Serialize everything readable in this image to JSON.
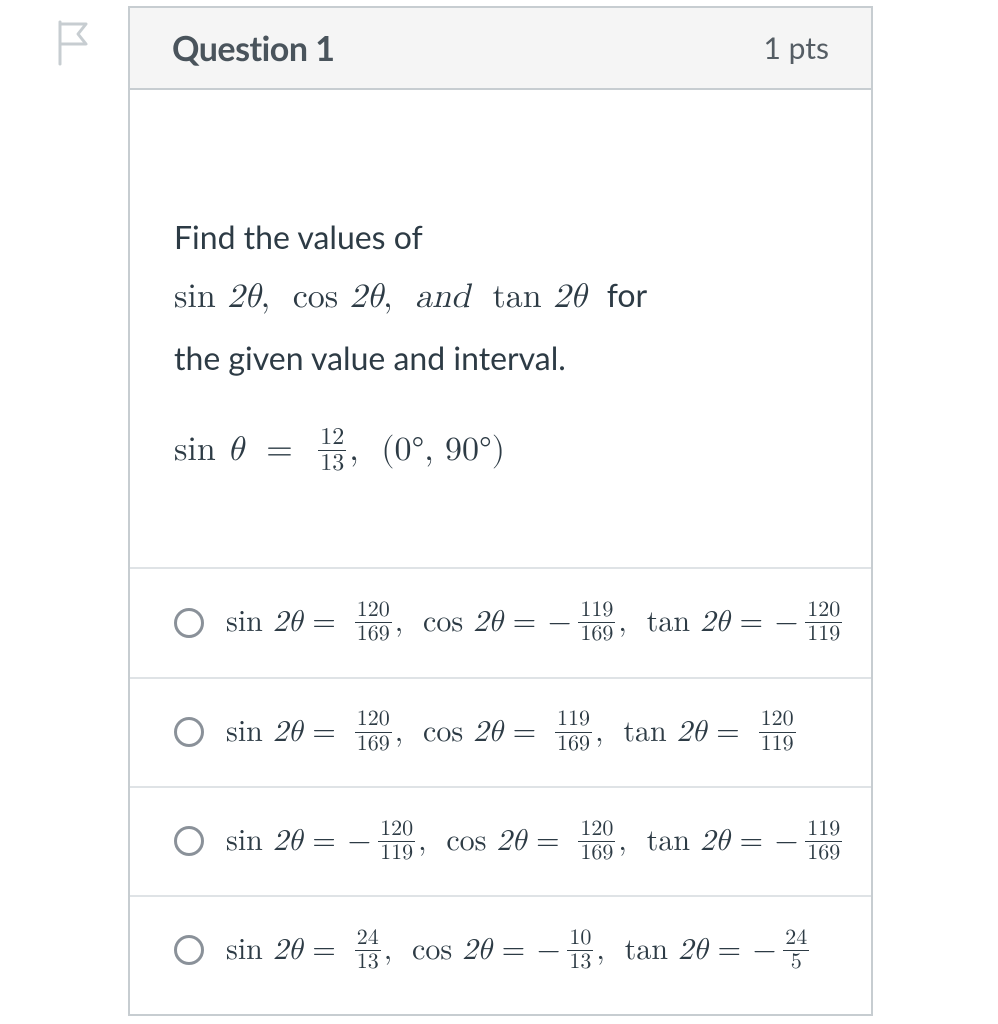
{
  "header": {
    "title": "Question 1",
    "points": "1 pts"
  },
  "prompt": {
    "line1": "Find the values of",
    "line3": "the given value and interval.",
    "sin": "sin",
    "cos": "cos",
    "tan_func": "tan",
    "and": "and",
    "for_word": "for",
    "twotheta": "2θ",
    "theta": "θ",
    "eq": "=",
    "comma": ",",
    "interval": "(0°, 90°)",
    "frac_num": "12",
    "frac_den": "13"
  },
  "options": [
    {
      "sin_sign": "",
      "sin_num": "120",
      "sin_den": "169",
      "cos_sign": "−",
      "cos_num": "119",
      "cos_den": "169",
      "tan_sign": "−",
      "tan_num": "120",
      "tan_den": "119"
    },
    {
      "sin_sign": "",
      "sin_num": "120",
      "sin_den": "169",
      "cos_sign": "",
      "cos_num": "119",
      "cos_den": "169",
      "tan_sign": "",
      "tan_num": "120",
      "tan_den": "119"
    },
    {
      "sin_sign": "−",
      "sin_num": "120",
      "sin_den": "119",
      "cos_sign": "",
      "cos_num": "120",
      "cos_den": "169",
      "tan_sign": "−",
      "tan_num": "119",
      "tan_den": "169"
    },
    {
      "sin_sign": "",
      "sin_num": "24",
      "sin_den": "13",
      "cos_sign": "−",
      "cos_num": "10",
      "cos_den": "13",
      "tan_sign": "−",
      "tan_num": "24",
      "tan_den": "5"
    }
  ]
}
